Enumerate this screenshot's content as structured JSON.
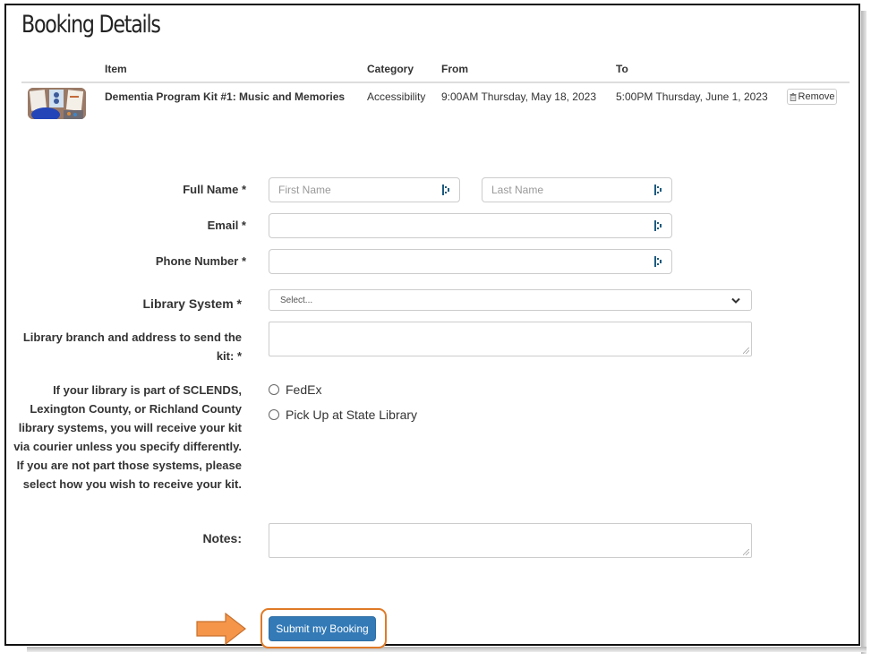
{
  "page": {
    "title": "Booking Details"
  },
  "table": {
    "headers": {
      "item": "Item",
      "category": "Category",
      "from": "From",
      "to": "To"
    },
    "rows": [
      {
        "thumbnail": "kit-photo",
        "item": "Dementia Program Kit #1: Music and Memories",
        "category": "Accessibility",
        "from": "9:00AM Thursday, May 18, 2023",
        "to": "5:00PM Thursday, June 1, 2023",
        "remove_label": "Remove",
        "remove_icon": "trash-icon"
      }
    ]
  },
  "form": {
    "full_name": {
      "label": "Full Name *",
      "first_placeholder": "First Name",
      "first_value": "",
      "last_placeholder": "Last Name",
      "last_value": ""
    },
    "email": {
      "label": "Email *",
      "value": "",
      "placeholder": ""
    },
    "phone": {
      "label": "Phone Number *",
      "value": "",
      "placeholder": ""
    },
    "library_system": {
      "label": "Library System *",
      "selected": "Select..."
    },
    "branch_address": {
      "label": "Library branch and address to send the kit: *",
      "value": ""
    },
    "delivery": {
      "label": "If your library is part of SCLENDS, Lexington County, or Richland County library systems, you will receive your kit via courier unless you specify differently. If you are not part those systems, please select how you wish to receive your kit.",
      "options": [
        "FedEx",
        "Pick Up at State Library"
      ]
    },
    "notes": {
      "label": "Notes:",
      "value": ""
    },
    "submit_label": "Submit my Booking"
  },
  "annotation": {
    "highlight_color": "#e07a26",
    "arrow_color": "#f4954a",
    "arrow_icon": "right-arrow-icon"
  }
}
